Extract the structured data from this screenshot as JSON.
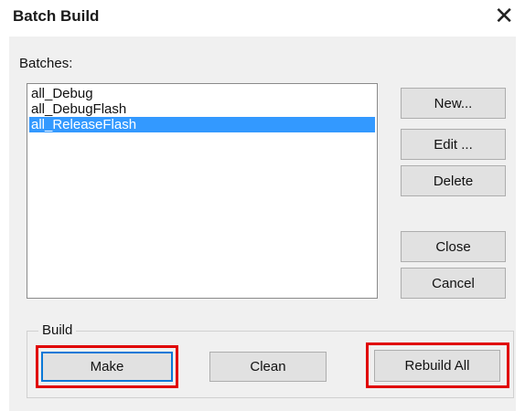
{
  "window": {
    "title": "Batch Build",
    "close_glyph": "✕"
  },
  "batches": {
    "label": "Batches:",
    "items": [
      {
        "label": "all_Debug",
        "selected": false
      },
      {
        "label": "all_DebugFlash",
        "selected": false
      },
      {
        "label": "all_ReleaseFlash",
        "selected": true
      }
    ]
  },
  "side_buttons": {
    "new": "New...",
    "edit": "Edit ...",
    "delete": "Delete",
    "close": "Close",
    "cancel": "Cancel"
  },
  "build": {
    "label": "Build",
    "make": "Make",
    "clean": "Clean",
    "rebuild_all": "Rebuild All"
  },
  "colors": {
    "selection": "#3399ff",
    "highlight_box": "#e00000",
    "focus_border": "#0a78d7"
  }
}
